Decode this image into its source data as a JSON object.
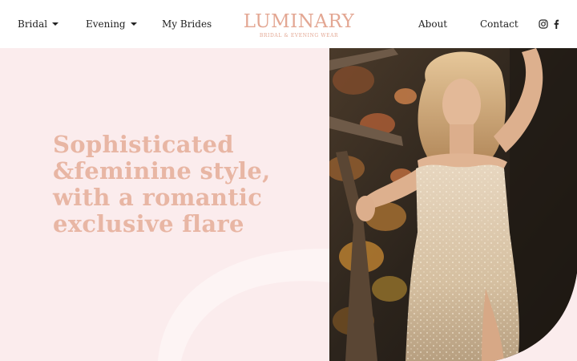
{
  "nav": {
    "items": [
      {
        "label": "Bridal",
        "dropdown": true
      },
      {
        "label": "Evening",
        "dropdown": true
      },
      {
        "label": "My Brides",
        "dropdown": false
      }
    ],
    "right_items": [
      {
        "label": "About"
      },
      {
        "label": "Contact"
      }
    ],
    "social_icons": [
      "instagram-icon",
      "facebook-icon"
    ]
  },
  "logo": {
    "name": "LUMINARY",
    "tagline": "BRIDAL & EVENING WEAR"
  },
  "hero": {
    "headline_lines": [
      "Sophisticated",
      "&feminine style,",
      "with a romantic",
      "exclusive flare"
    ],
    "image_subject": "model in a strapless embellished gown among autumn leaves"
  },
  "colors": {
    "accent": "#e3a793",
    "headline": "#e8b6a4",
    "background": "#fbeced",
    "nav_background": "#ffffff",
    "text": "#222222"
  }
}
